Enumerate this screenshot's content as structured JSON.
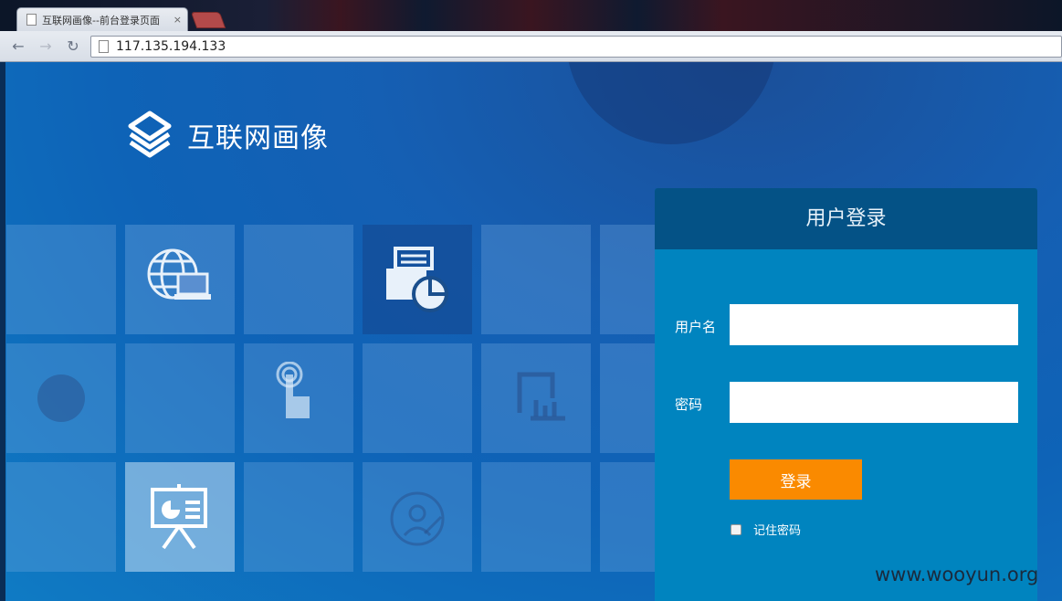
{
  "browser": {
    "tab_title": "互联网画像--前台登录页面",
    "tab_close": "×",
    "address": "117.135.194.133"
  },
  "page": {
    "brand_name": "互联网画像",
    "login": {
      "title": "用户登录",
      "username_label": "用户名",
      "password_label": "密码",
      "username_value": "",
      "password_value": "",
      "submit_label": "登录",
      "remember_label": "记住密码",
      "remember_checked": false
    },
    "watermark": "www.wooyun.org"
  },
  "colors": {
    "login_header": "#045286",
    "login_panel": "#0084bf",
    "login_button": "#fa8a00"
  },
  "icons": [
    "globe-computer-icon",
    "document-pie-icon",
    "touch-icon",
    "chart-frame-icon",
    "presentation-icon",
    "user-growth-icon"
  ]
}
